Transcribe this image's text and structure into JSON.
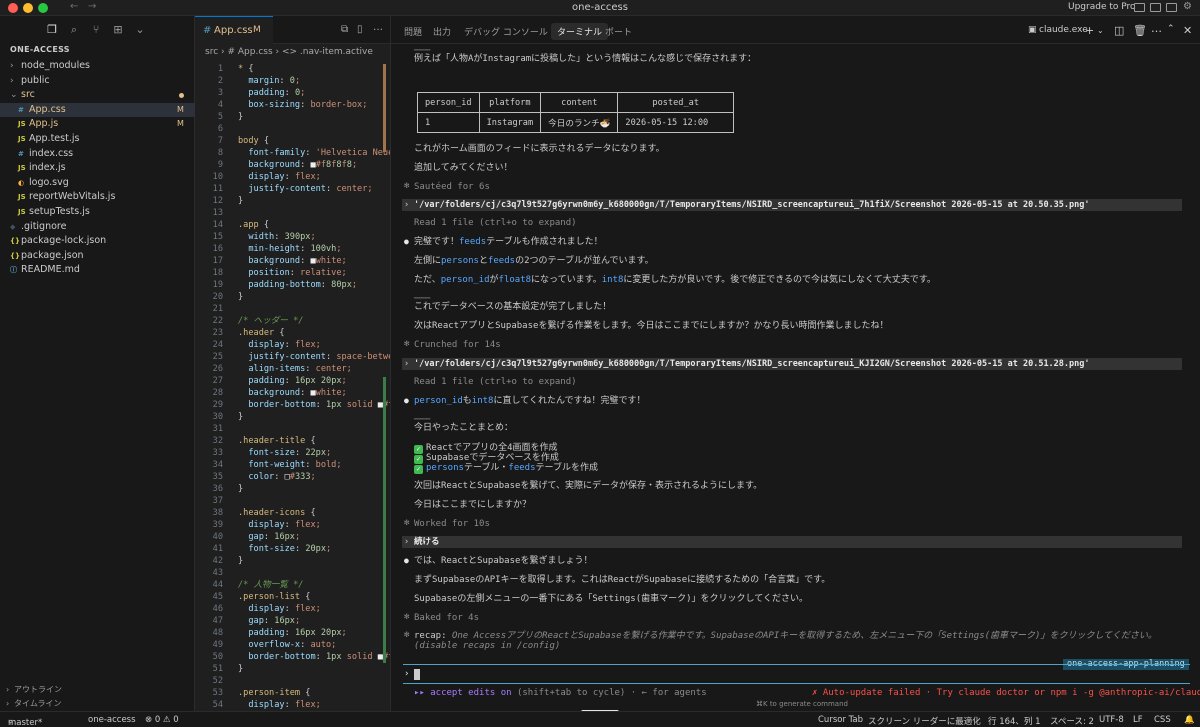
{
  "window": {
    "title": "one-access",
    "upgrade": "Upgrade to Pro"
  },
  "explorer": {
    "project": "ONE-ACCESS",
    "items": [
      {
        "name": "node_modules",
        "kind": "folder",
        "indent": 0,
        "open": false
      },
      {
        "name": "public",
        "kind": "folder",
        "indent": 0,
        "open": false
      },
      {
        "name": "src",
        "kind": "folder",
        "indent": 0,
        "open": true,
        "status": "dot",
        "color": "#e2c08d"
      },
      {
        "name": "App.css",
        "kind": "css",
        "indent": 1,
        "status": "M",
        "selected": true,
        "color": "#e2c08d"
      },
      {
        "name": "App.js",
        "kind": "js",
        "indent": 1,
        "status": "M",
        "color": "#e2c08d"
      },
      {
        "name": "App.test.js",
        "kind": "js",
        "indent": 1
      },
      {
        "name": "index.css",
        "kind": "css",
        "indent": 1
      },
      {
        "name": "index.js",
        "kind": "js",
        "indent": 1
      },
      {
        "name": "logo.svg",
        "kind": "svg",
        "indent": 1
      },
      {
        "name": "reportWebVitals.js",
        "kind": "js",
        "indent": 1
      },
      {
        "name": "setupTests.js",
        "kind": "js",
        "indent": 1
      },
      {
        "name": ".gitignore",
        "kind": "git",
        "indent": 0
      },
      {
        "name": "package-lock.json",
        "kind": "json",
        "indent": 0
      },
      {
        "name": "package.json",
        "kind": "json",
        "indent": 0
      },
      {
        "name": "README.md",
        "kind": "md",
        "indent": 0
      }
    ],
    "outline": "アウトライン",
    "timeline": "タイムライン"
  },
  "editor": {
    "tab": {
      "name": "App.css",
      "status": "M"
    },
    "breadcrumb": [
      "src",
      "# App.css",
      "<> .nav-item.active"
    ],
    "lines": [
      [
        "1",
        "* {"
      ],
      [
        "2",
        "  margin: 0;"
      ],
      [
        "3",
        "  padding: 0;"
      ],
      [
        "4",
        "  box-sizing: border-box;"
      ],
      [
        "5",
        "}"
      ],
      [
        "6",
        ""
      ],
      [
        "7",
        "body {"
      ],
      [
        "8",
        "  font-family: 'Helvetica Neue'"
      ],
      [
        "9",
        "  background: ■#f8f8f8;"
      ],
      [
        "10",
        "  display: flex;"
      ],
      [
        "11",
        "  justify-content: center;"
      ],
      [
        "12",
        "}"
      ],
      [
        "13",
        ""
      ],
      [
        "14",
        ".app {"
      ],
      [
        "15",
        "  width: 390px;"
      ],
      [
        "16",
        "  min-height: 100vh;"
      ],
      [
        "17",
        "  background: ■white;"
      ],
      [
        "18",
        "  position: relative;"
      ],
      [
        "19",
        "  padding-bottom: 80px;"
      ],
      [
        "20",
        "}"
      ],
      [
        "21",
        ""
      ],
      [
        "22",
        "/* ヘッダー */"
      ],
      [
        "23",
        ".header {"
      ],
      [
        "24",
        "  display: flex;"
      ],
      [
        "25",
        "  justify-content: space-betwee"
      ],
      [
        "26",
        "  align-items: center;"
      ],
      [
        "27",
        "  padding: 16px 20px;"
      ],
      [
        "28",
        "  background: ■white;"
      ],
      [
        "29",
        "  border-bottom: 1px solid ■#f("
      ],
      [
        "30",
        "}"
      ],
      [
        "31",
        ""
      ],
      [
        "32",
        ".header-title {"
      ],
      [
        "33",
        "  font-size: 22px;"
      ],
      [
        "34",
        "  font-weight: bold;"
      ],
      [
        "35",
        "  color: □#333;"
      ],
      [
        "36",
        "}"
      ],
      [
        "37",
        ""
      ],
      [
        "38",
        ".header-icons {"
      ],
      [
        "39",
        "  display: flex;"
      ],
      [
        "40",
        "  gap: 16px;"
      ],
      [
        "41",
        "  font-size: 20px;"
      ],
      [
        "42",
        "}"
      ],
      [
        "43",
        ""
      ],
      [
        "44",
        "/* 人物一覧 */"
      ],
      [
        "45",
        ".person-list {"
      ],
      [
        "46",
        "  display: flex;"
      ],
      [
        "47",
        "  gap: 16px;"
      ],
      [
        "48",
        "  padding: 16px 20px;"
      ],
      [
        "49",
        "  overflow-x: auto;"
      ],
      [
        "50",
        "  border-bottom: 1px solid ■#f"
      ],
      [
        "51",
        "}"
      ],
      [
        "52",
        ""
      ],
      [
        "53",
        ".person-item {"
      ],
      [
        "54",
        "  display: flex;"
      ]
    ]
  },
  "panel": {
    "tabs": [
      "問題",
      "出力",
      "デバッグ コンソール",
      "ターミナル",
      "ポート"
    ],
    "active_tab": "ターミナル",
    "terminal_name": "claude.exe",
    "terminal": {
      "intro_rule": "───",
      "intro": "例えば「人物AがInstagramに投稿した」という情報はこんな感じで保存されます：",
      "table": {
        "headers": [
          "person_id",
          "platform",
          "content",
          "posted_at"
        ],
        "row": [
          "1",
          "Instagram",
          "今日のランチ🍜",
          "2026-05-15 12:00"
        ]
      },
      "after_table_1": "これがホーム画面のフィードに表示されるデータになります。",
      "after_table_2": "追加してみてください！",
      "sauteed": "Sautéed for 6s",
      "cmd1": "'/var/folders/cj/c3q7l9t527g6yrwn0m6y_k680000gn/T/TemporaryItems/NSIRD_screencaptureui_7h1fiX/Screenshot 2026-05-15 at 20.50.35.png'",
      "read1": "Read 1 file (ctrl+o to expand)",
      "msg1_a": "完璧です！",
      "msg1_hl": "feeds",
      "msg1_b": "テーブルも作成されました！",
      "msg2_a": "左側に",
      "msg2_hl1": "persons",
      "msg2_b": "と",
      "msg2_hl2": "feeds",
      "msg2_c": "の2つのテーブルが並んでいます。",
      "msg3_a": "ただ、",
      "msg3_hl1": "person_id",
      "msg3_b": "が",
      "msg3_hl2": "float8",
      "msg3_c": "になっています。",
      "msg3_hl3": "int8",
      "msg3_d": "に変更した方が良いです。後で修正できるので今は気にしなくて大丈夫です。",
      "rule2": "───",
      "msg4": "これでデータベースの基本設定が完了しました！",
      "msg5": "次はReactアプリとSupabaseを繋げる作業をします。今日はここまでにしますか？かなり長い時間作業しましたね！",
      "crunched": "Crunched for 14s",
      "cmd2": "'/var/folders/cj/c3q7l9t527g6yrwn0m6y_k680000gn/T/TemporaryItems/NSIRD_screencaptureui_KJI2GN/Screenshot 2026-05-15 at 20.51.28.png'",
      "read2": "Read 1 file (ctrl+o to expand)",
      "msg6_hl1": "person_id",
      "msg6_a": "も",
      "msg6_hl2": "int8",
      "msg6_b": "に直してくれたんですね！完璧です！",
      "rule3": "───",
      "summary": "今日やったことまとめ：",
      "done1": "Reactでアプリの全4画面を作成",
      "done2": "Supabaseでデータベースを作成",
      "done3_hl1": "persons",
      "done3_a": "テーブル・",
      "done3_hl2": "feeds",
      "done3_b": "テーブルを作成",
      "next": "次回はReactとSupabaseを繋げて、実際にデータが保存・表示されるようにします。",
      "ask": "今日はここまでにしますか？",
      "worked": "Worked for 10s",
      "cmd3": "続ける",
      "go": "では、ReactとSupabaseを繋ぎましょう！",
      "api": "まずSupabaseのAPIキーを取得します。これはReactがSupabaseに接続するための「合言葉」です。",
      "settings": "Supabaseの左側メニューの一番下にある「Settings(歯車マーク)」をクリックしてください。",
      "baked": "Baked for 4s",
      "recap_label": "recap:",
      "recap": "One AccessアプリのReactとSupabaseを繋げる作業中です。SupabaseのAPIキーを取得するため、左メニュー下の「Settings(歯車マーク)」をクリックしてください。",
      "recap2": "(disable recaps in /config)",
      "plan_tag": "one-access-app-planning",
      "prompt": "›",
      "mode_a": "▸▸ accept edits on",
      "mode_b": "(shift+tab to cycle) · ← for agents",
      "update_a": "✗ Auto-update failed · Try",
      "update_b": "claude doctor",
      "update_c": "or",
      "update_d": "npm i -g @anthropic-ai/claude-code",
      "hint": "⌘K to generate command"
    }
  },
  "status": {
    "branch": "master*",
    "project": "one-access",
    "problems": "⊗ 0 ⚠ 0",
    "cursor_tab": "Cursor Tab",
    "reader": "スクリーン リーダーに最適化",
    "position": "行 164、列 1",
    "spaces": "スペース: 2",
    "encoding": "UTF-8",
    "eol": "LF",
    "lang": "CSS"
  }
}
